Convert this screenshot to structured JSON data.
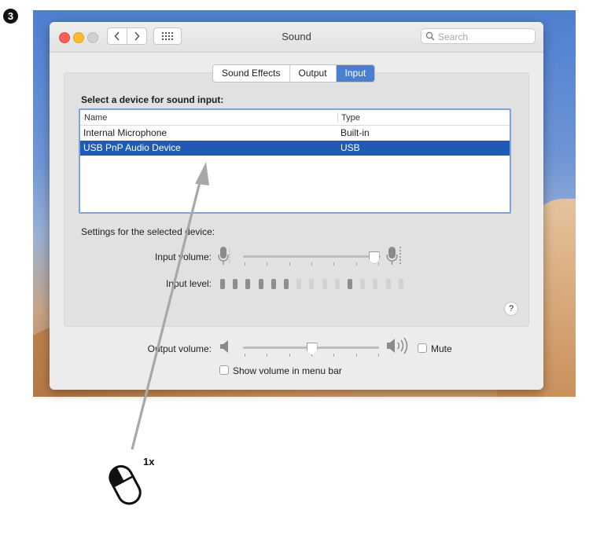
{
  "step_number": "3",
  "click_count_label": "1x",
  "window": {
    "title": "Sound",
    "search_placeholder": "Search"
  },
  "tabs": [
    {
      "label": "Sound Effects",
      "active": false
    },
    {
      "label": "Output",
      "active": false
    },
    {
      "label": "Input",
      "active": true
    }
  ],
  "input_pane": {
    "heading": "Select a device for sound input:",
    "columns": {
      "name": "Name",
      "type": "Type"
    },
    "devices": [
      {
        "name": "Internal Microphone",
        "type": "Built-in",
        "selected": false
      },
      {
        "name": "USB PnP Audio Device",
        "type": "USB",
        "selected": true
      }
    ],
    "settings_label": "Settings for the selected device:",
    "input_volume_label": "Input volume:",
    "input_volume_fraction": 0.98,
    "input_level_label": "Input level:",
    "input_level_segments_lit": 6,
    "input_level_segments_total": 15,
    "input_level_peak_index": 10,
    "help_label": "?"
  },
  "output": {
    "volume_label": "Output volume:",
    "volume_fraction": 0.5,
    "mute_label": "Mute",
    "mute_checked": false,
    "show_volume_label": "Show volume in menu bar",
    "show_volume_checked": false
  },
  "colors": {
    "accent": "#1f5ab5",
    "tab_active": "#4a7fd1",
    "close": "#fc5f57",
    "minimize": "#fdbc2e",
    "pointer_arrow": "#a8a8a8"
  },
  "icons": {
    "back": "chevron-left-icon",
    "forward": "chevron-right-icon",
    "show_all": "grid-icon",
    "search": "search-icon",
    "mic_low": "microphone-low-icon",
    "mic_high": "microphone-high-icon",
    "speaker_low": "speaker-low-icon",
    "speaker_high": "speaker-high-icon",
    "mouse": "mouse-left-click-icon"
  }
}
